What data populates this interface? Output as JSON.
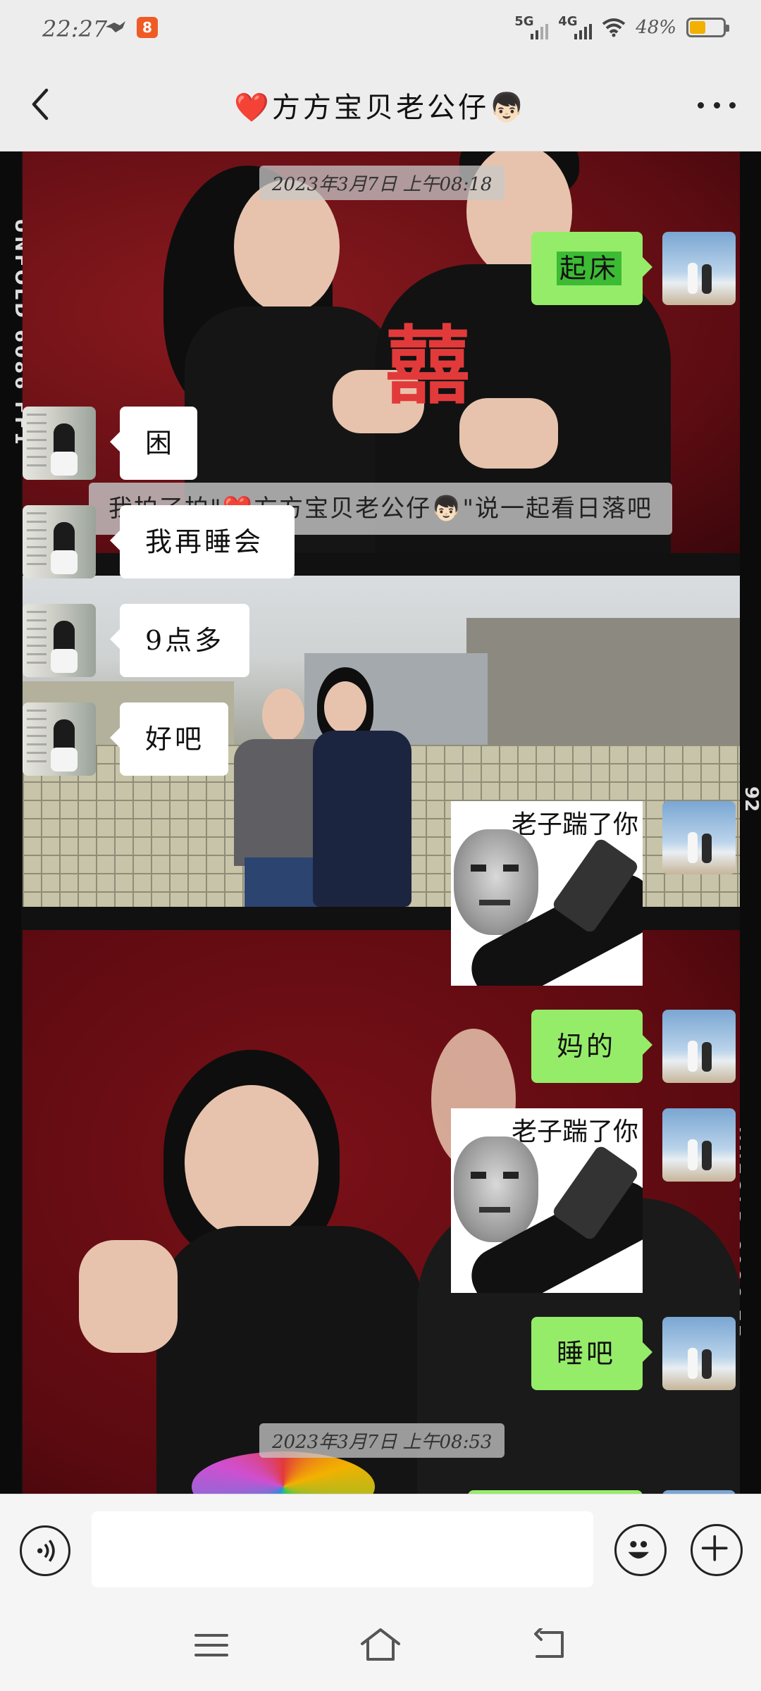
{
  "status_bar": {
    "time": "22:27",
    "app_badge": "8",
    "network_1": "5G",
    "network_2": "4G",
    "battery_percent": "48%",
    "battery_level": 0.48,
    "accent_battery": "#f2b100"
  },
  "header": {
    "title": "❤️方方宝贝老公仔👦🏻",
    "back_icon": "chevron-left-icon",
    "more_icon": "more-dots-icon"
  },
  "background": {
    "film_text_left": "UNFOLD 6086 FF1",
    "film_text_right": "UNFOLD 6086 FF",
    "film_number_right": "92",
    "wedding_glyph": "囍"
  },
  "messages": {
    "timestamp_1": "2023年3月7日 上午08:18",
    "msg_1": "起床",
    "system_1": "我拍了拍\"❤️方方宝贝老公仔👦🏻\"说一起看日落吧",
    "msg_2": "困",
    "msg_3": "我再睡会",
    "msg_4": "9点多",
    "msg_5": "好吧",
    "sticker_1_caption": "老子踹了你",
    "msg_6": "妈的",
    "sticker_2_caption": "老子踹了你",
    "msg_7": "睡吧",
    "timestamp_2": "2023年3月7日 上午08:53"
  },
  "colors": {
    "bubble_self": "#95ec69",
    "bubble_other": "#ffffff",
    "highlight": "#3dbb34"
  },
  "input_bar": {
    "text_value": "",
    "voice_icon": "voice-icon",
    "emoji_icon": "emoji-icon",
    "plus_icon": "plus-icon"
  },
  "nav_bar": {
    "menu_icon": "menu-icon",
    "home_icon": "home-icon",
    "back_icon": "back-icon"
  }
}
